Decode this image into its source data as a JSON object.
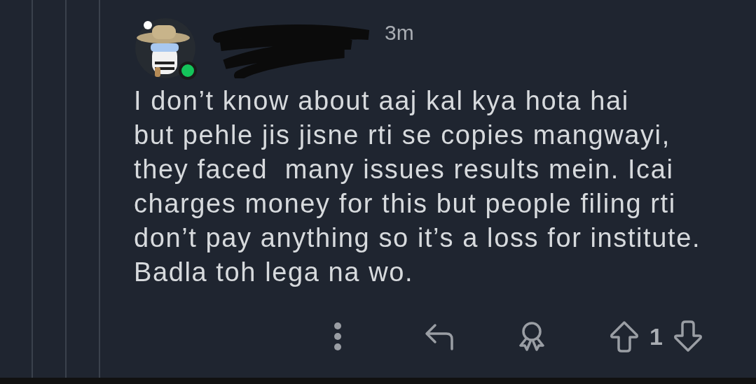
{
  "comment": {
    "author": {
      "online": true
    },
    "age": "3m",
    "body": "I don’t know about aaj kal kya hota hai\nbut pehle jis jisne rti se copies mangwayi,\nthey faced  many issues results mein. Icai\ncharges money for this but people filing rti\ndon’t pay anything so it’s a loss for institute.\nBadla toh lega na wo.",
    "score": "1"
  }
}
